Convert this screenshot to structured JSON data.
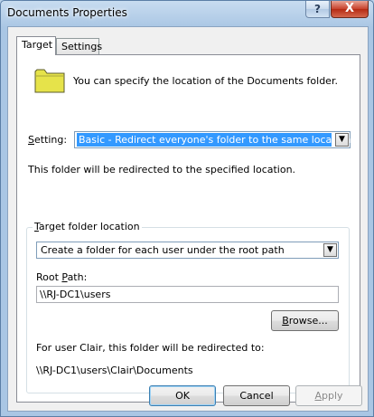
{
  "window": {
    "title": "Documents Properties",
    "help_glyph": "?",
    "close_glyph": "X"
  },
  "tabs": [
    {
      "label": "Target",
      "active": true
    },
    {
      "label": "Settings",
      "active": false
    }
  ],
  "target": {
    "description": "You can specify the location of the Documents folder.",
    "setting_label": "Setting:",
    "setting_value": "Basic - Redirect everyone's folder to the same location",
    "redirect_info": "This folder will be redirected to the specified location.",
    "group_label": "Target folder location",
    "location_value": "Create a folder for each user under the root path",
    "root_path_label": "Root Path:",
    "root_path_value": "\\\\RJ-DC1\\users",
    "browse_label": "Browse...",
    "example_text": "For user Clair, this folder will be redirected to:",
    "example_path": "\\\\RJ-DC1\\users\\Clair\\Documents"
  },
  "buttons": {
    "ok": "OK",
    "cancel": "Cancel",
    "apply": "Apply"
  },
  "colors": {
    "selection": "#3399ff",
    "folder_yellow": "#e6e34a"
  }
}
